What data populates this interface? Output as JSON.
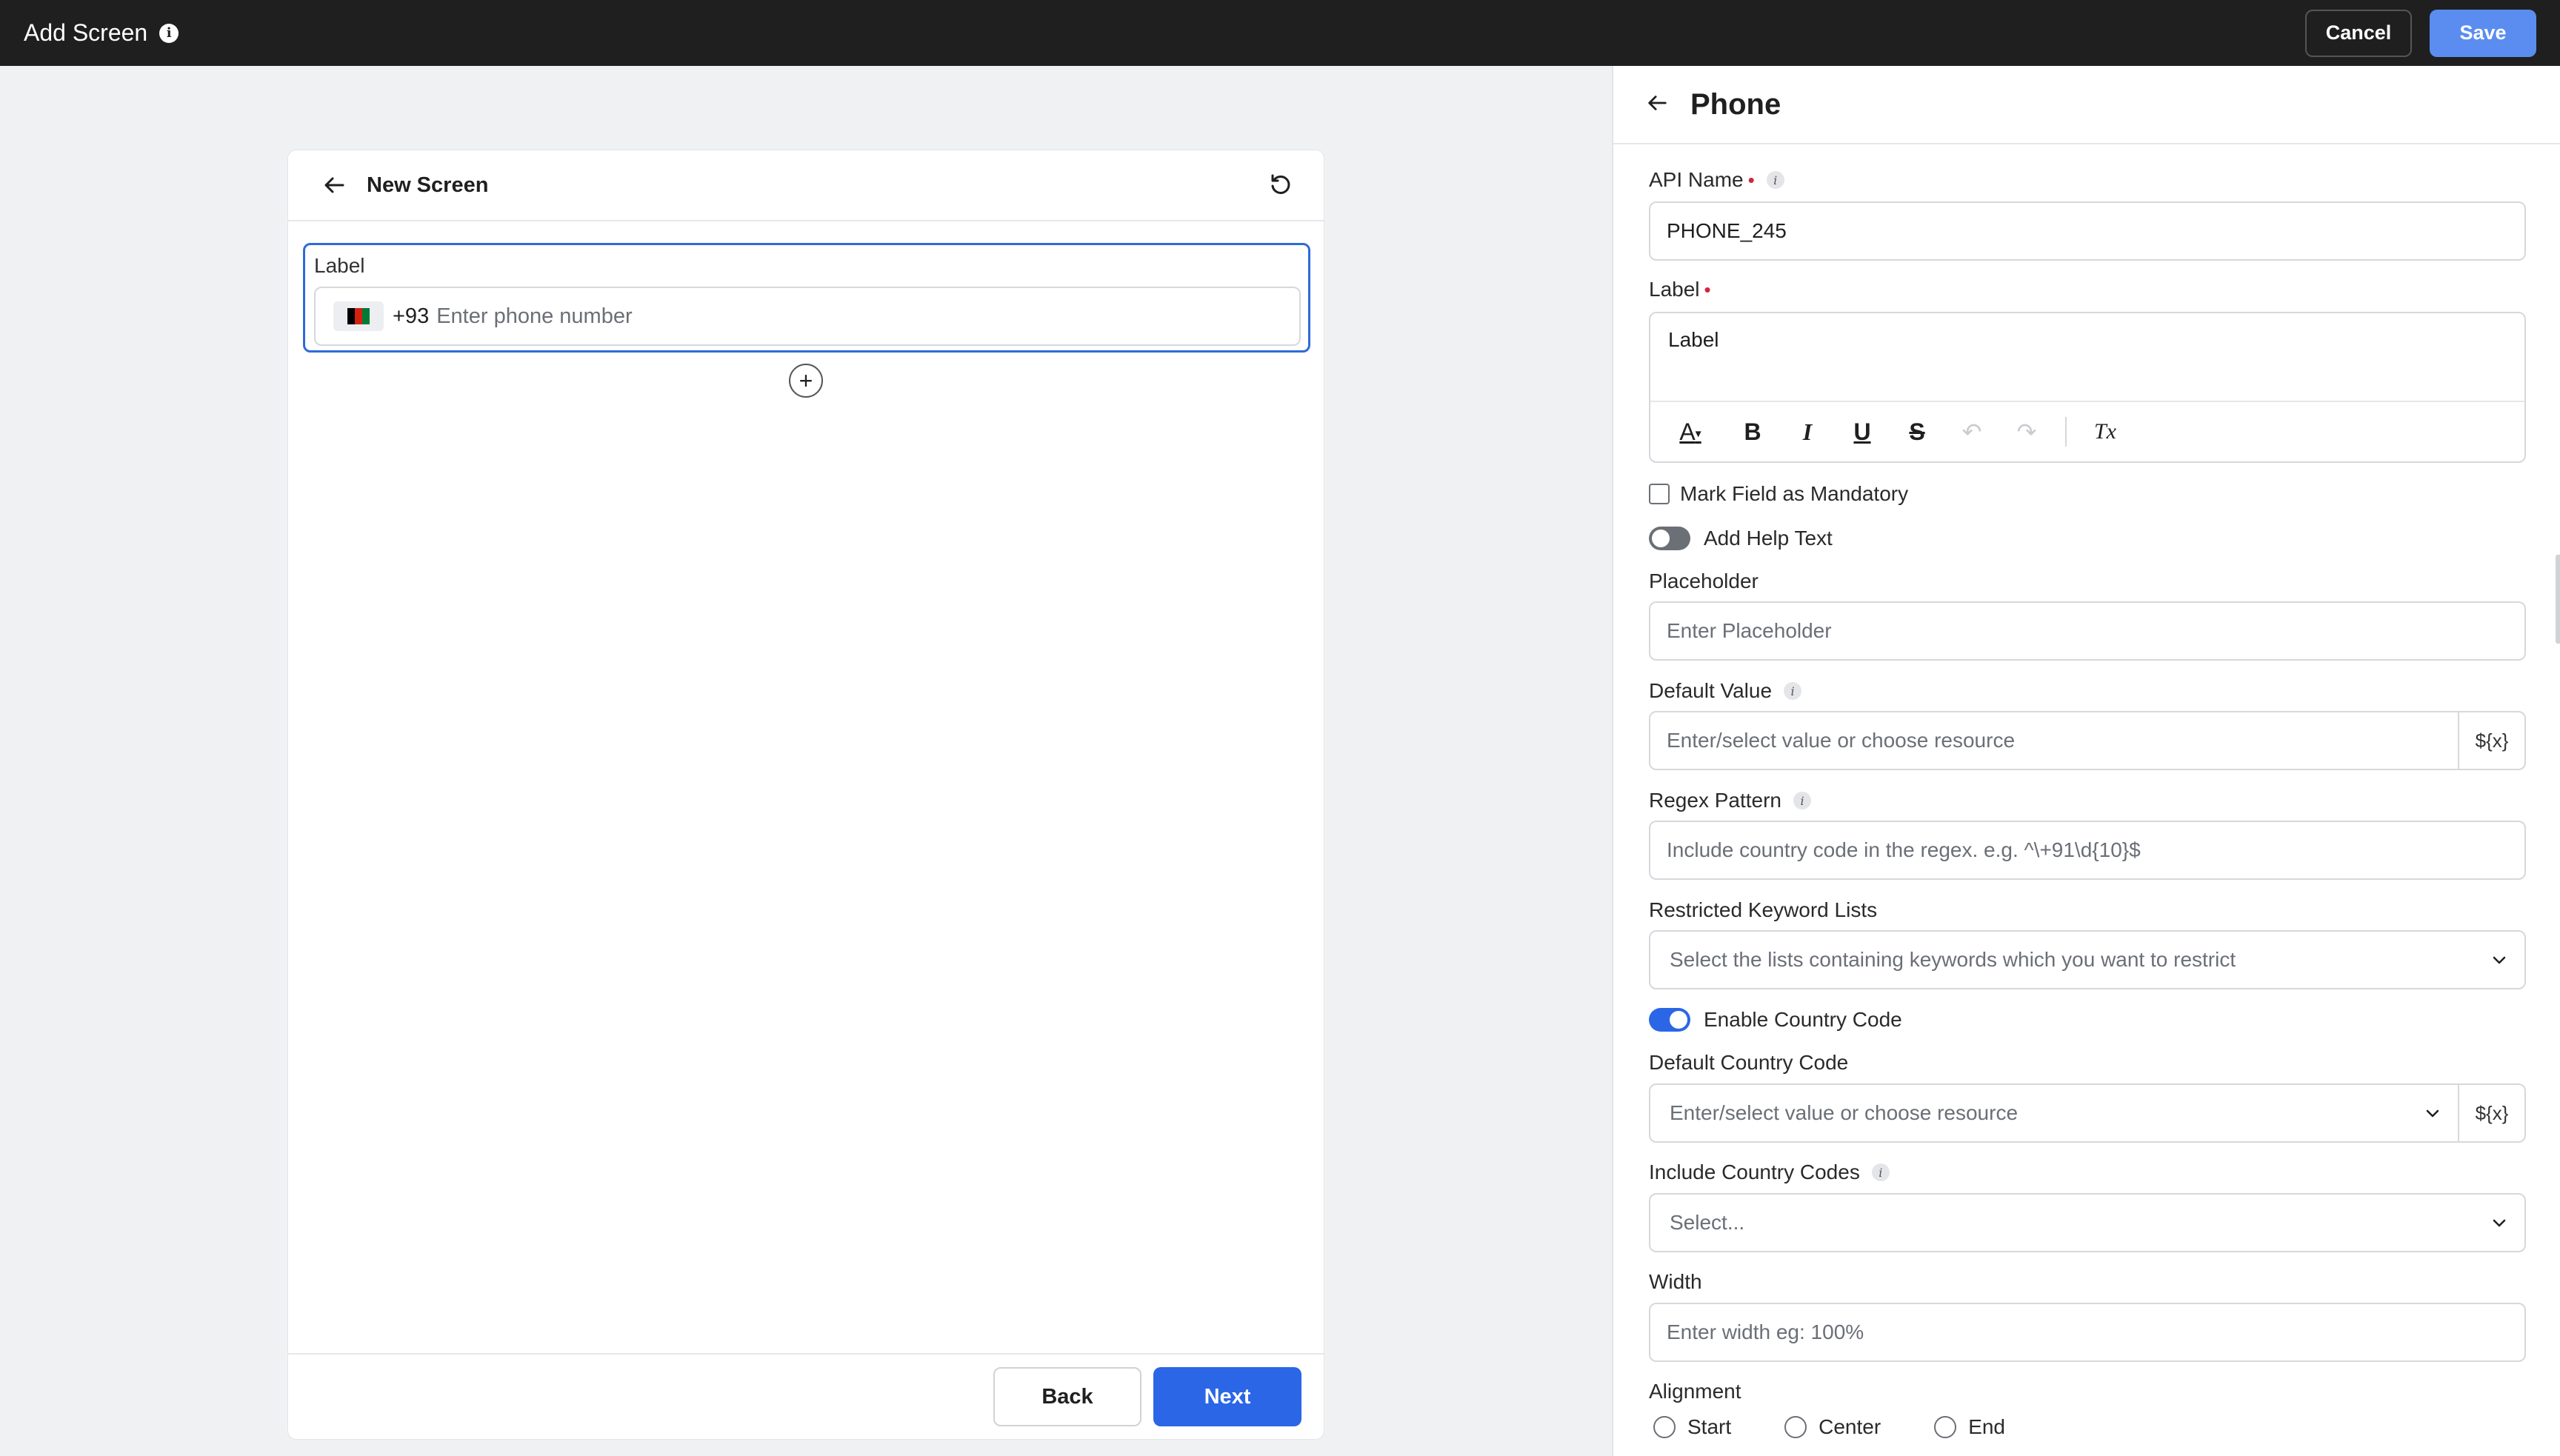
{
  "topbar": {
    "title": "Add Screen",
    "cancel_label": "Cancel",
    "save_label": "Save"
  },
  "canvas": {
    "card_title": "New Screen",
    "field_label": "Label",
    "phone_code": "+93",
    "phone_placeholder": "Enter phone number",
    "back_label": "Back",
    "next_label": "Next"
  },
  "panel": {
    "title": "Phone",
    "api_name_label": "API Name",
    "api_name_value": "PHONE_245",
    "label_label": "Label",
    "label_value": "Label",
    "toolbar": {
      "font_color": "A",
      "bold": "B",
      "italic": "I",
      "underline": "U",
      "strike": "S",
      "undo": "↶",
      "redo": "↷",
      "clear_format": "Tx"
    },
    "mandatory_label": "Mark Field as Mandatory",
    "help_text_label": "Add Help Text",
    "placeholder_label": "Placeholder",
    "placeholder_ph": "Enter Placeholder",
    "default_value_label": "Default Value",
    "default_value_ph": "Enter/select value or choose resource",
    "resource_token": "${x}",
    "regex_label": "Regex Pattern",
    "regex_ph": "Include country code in the regex. e.g. ^\\+91\\d{10}$",
    "restricted_label": "Restricted Keyword Lists",
    "restricted_ph": "Select the lists containing keywords which you want to restrict",
    "country_code_toggle_label": "Enable Country Code",
    "default_country_label": "Default Country Code",
    "default_country_ph": "Enter/select value or choose resource",
    "include_codes_label": "Include Country Codes",
    "include_codes_ph": "Select...",
    "width_label": "Width",
    "width_ph": "Enter width eg: 100%",
    "alignment_label": "Alignment",
    "alignment_options": [
      "Start",
      "Center",
      "End"
    ]
  },
  "colors": {
    "topbar_bg": "#1f1f1f",
    "save_button": "#5a8def",
    "primary": "#2b66e6",
    "focus_border": "#2f6bd9",
    "required": "#d0263b"
  }
}
